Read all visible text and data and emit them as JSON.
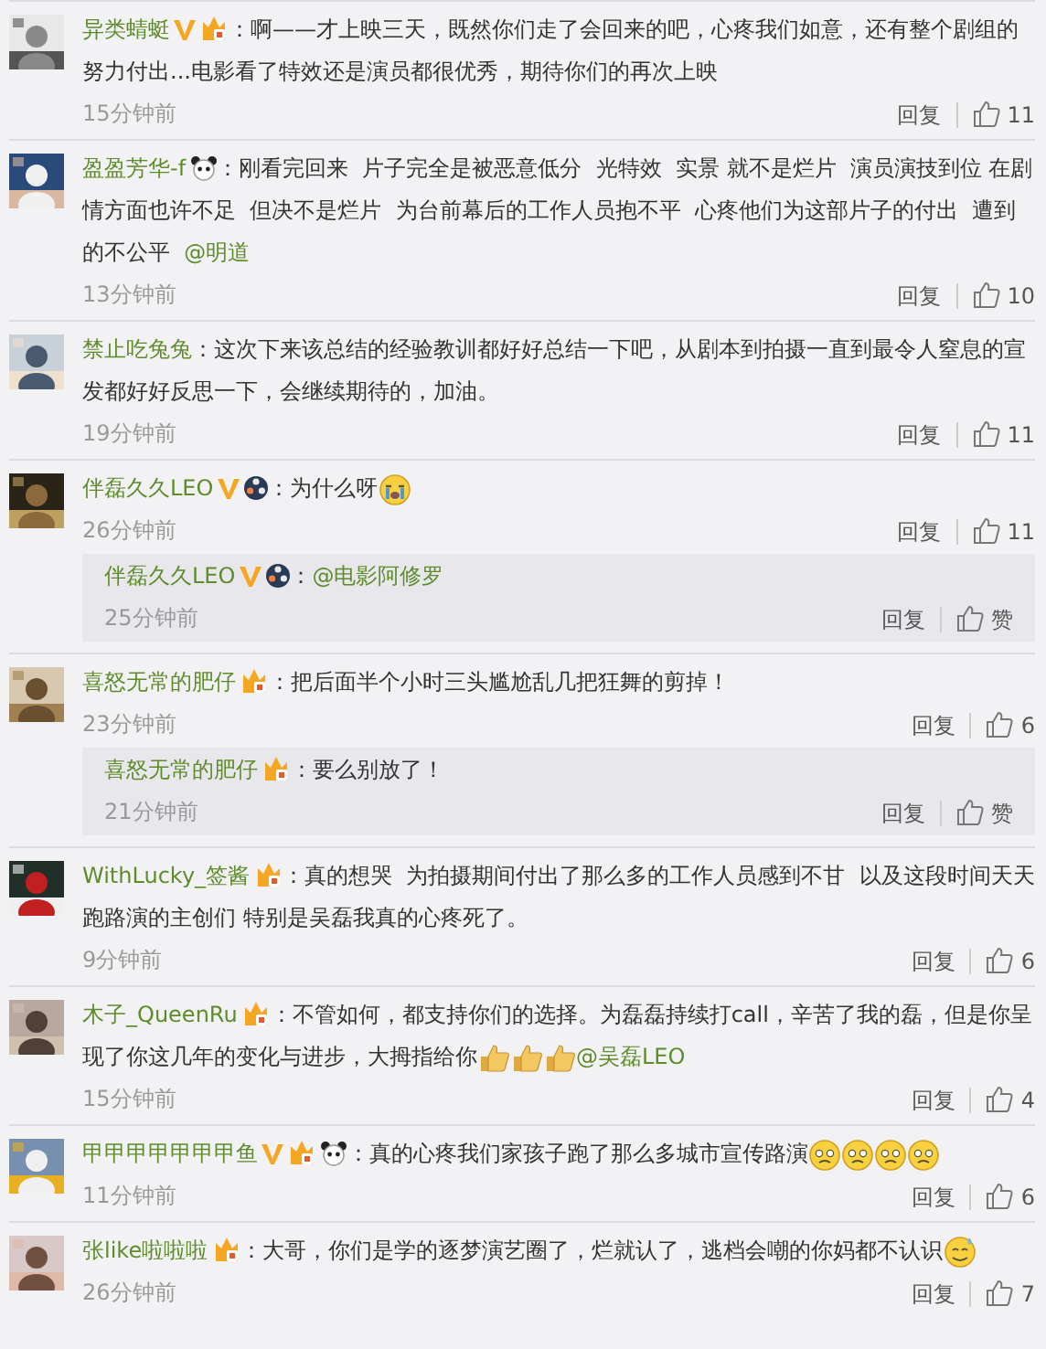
{
  "comments": [
    {
      "name": "异类蜻蜓",
      "badges": [
        {
          "kind": "verified"
        },
        {
          "kind": "vip"
        }
      ],
      "content": [
        {
          "kind": "text",
          "text": "：啊——才上映三天，既然你们走了会回来的吧，心疼我们如意，还有整个剧组的努力付出...电影看了特效还是演员都很优秀，期待你们的再次上映"
        }
      ],
      "time": "15分钟前",
      "reply_label": "回复",
      "likes": "11"
    },
    {
      "name": "盈盈芳华-f",
      "badges": [
        {
          "kind": "panda"
        }
      ],
      "content": [
        {
          "kind": "text",
          "text": "：刚看完回来  片子完全是被恶意低分  光特效  实景 就不是烂片  演员演技到位 在剧情方面也许不足  但决不是烂片  为台前幕后的工作人员抱不平  心疼他们为这部片子的付出  遭到的不公平  "
        },
        {
          "kind": "mention",
          "text": "@明道"
        }
      ],
      "time": "13分钟前",
      "reply_label": "回复",
      "likes": "10"
    },
    {
      "name": "禁止吃兔兔",
      "content": [
        {
          "kind": "text",
          "text": "：这次下来该总结的经验教训都好好总结一下吧，从剧本到拍摄一直到最令人窒息的宣发都好好反思一下，会继续期待的，加油。"
        }
      ],
      "time": "19分钟前",
      "reply_label": "回复",
      "likes": "11"
    },
    {
      "name": "伴磊久久LEO",
      "badges": [
        {
          "kind": "verified"
        },
        {
          "kind": "reel"
        }
      ],
      "content": [
        {
          "kind": "text",
          "text": "：为什么呀"
        },
        {
          "kind": "cry"
        }
      ],
      "time": "26分钟前",
      "reply_label": "回复",
      "likes": "11",
      "replies": [
        {
          "name": "伴磊久久LEO",
          "badges": [
            {
              "kind": "verified"
            },
            {
              "kind": "reel"
            }
          ],
          "content": [
            {
              "kind": "text",
              "text": "："
            },
            {
              "kind": "mention",
              "text": "@电影阿修罗"
            }
          ],
          "time": "25分钟前",
          "reply_label": "回复",
          "likes": "赞"
        }
      ]
    },
    {
      "name": "喜怒无常的肥仔",
      "badges": [
        {
          "kind": "vip"
        }
      ],
      "content": [
        {
          "kind": "text",
          "text": "：把后面半个小时三头尴尬乱几把狂舞的剪掉！"
        }
      ],
      "time": "23分钟前",
      "reply_label": "回复",
      "likes": "6",
      "replies": [
        {
          "name": "喜怒无常的肥仔",
          "badges": [
            {
              "kind": "vip"
            }
          ],
          "content": [
            {
              "kind": "text",
              "text": "：要么别放了！"
            }
          ],
          "time": "21分钟前",
          "reply_label": "回复",
          "likes": "赞"
        }
      ]
    },
    {
      "name": "WithLucky_签酱",
      "badges": [
        {
          "kind": "vip"
        }
      ],
      "content": [
        {
          "kind": "text",
          "text": "：真的想哭  为拍摄期间付出了那么多的工作人员感到不甘  以及这段时间天天跑路演的主创们 特别是吴磊我真的心疼死了。"
        }
      ],
      "time": "9分钟前",
      "reply_label": "回复",
      "likes": "6"
    },
    {
      "name": "木子_QueenRu",
      "badges": [
        {
          "kind": "vip"
        }
      ],
      "content": [
        {
          "kind": "text",
          "text": "：不管如何，都支持你们的选择。为磊磊持续打call，辛苦了我的磊，但是你呈现了你这几年的变化与进步，大拇指给你"
        },
        {
          "kind": "thumb"
        },
        {
          "kind": "thumb"
        },
        {
          "kind": "thumb"
        },
        {
          "kind": "mention",
          "text": "@吴磊LEO"
        }
      ],
      "time": "15分钟前",
      "reply_label": "回复",
      "likes": "4"
    },
    {
      "name": "甲甲甲甲甲甲甲鱼",
      "badges": [
        {
          "kind": "verified"
        },
        {
          "kind": "vip"
        },
        {
          "kind": "panda"
        }
      ],
      "content": [
        {
          "kind": "text",
          "text": "：真的心疼我们家孩子跑了那么多城市宣传路演"
        },
        {
          "kind": "sad"
        },
        {
          "kind": "sad"
        },
        {
          "kind": "sad"
        },
        {
          "kind": "sad"
        }
      ],
      "time": "11分钟前",
      "reply_label": "回复",
      "likes": "6"
    },
    {
      "name": "张like啦啦啦",
      "badges": [
        {
          "kind": "vip"
        }
      ],
      "content": [
        {
          "kind": "text",
          "text": "：大哥，你们是学的逐梦演艺圈了，烂就认了，逃档会嘲的你妈都不认识"
        },
        {
          "kind": "sweat"
        }
      ],
      "time": "26分钟前",
      "reply_label": "回复",
      "likes": "7"
    }
  ]
}
